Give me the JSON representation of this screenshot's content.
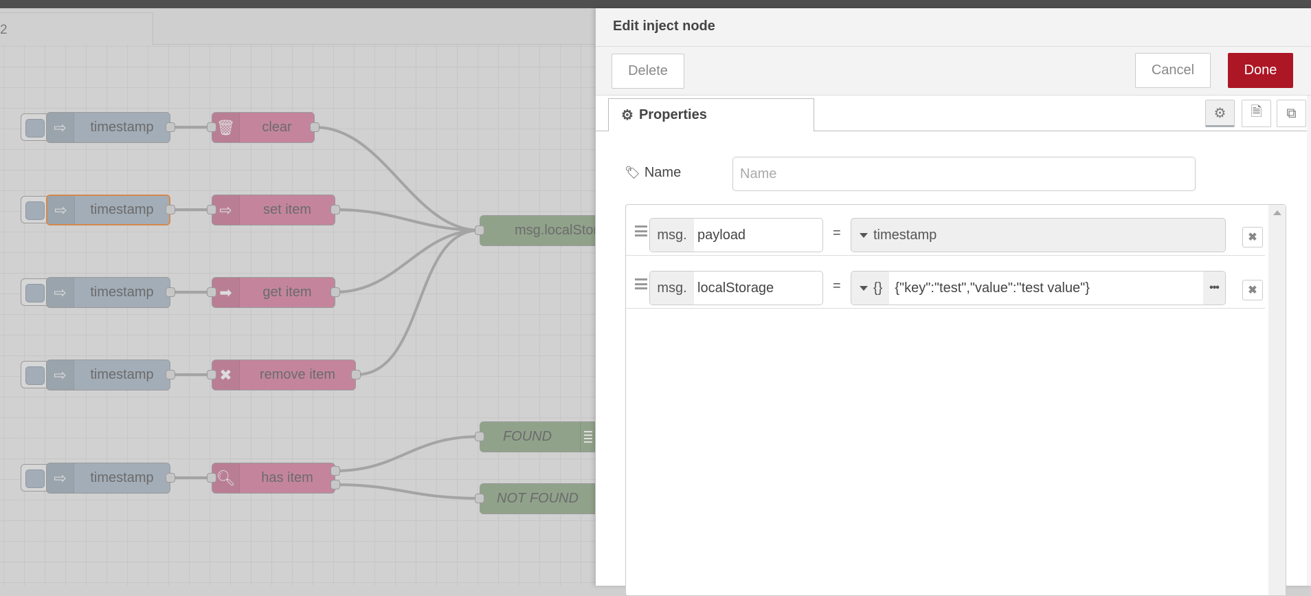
{
  "workspace": {
    "tab_label": "2",
    "nodes": {
      "inject": [
        {
          "label": "timestamp",
          "selected": false
        },
        {
          "label": "timestamp",
          "selected": true
        },
        {
          "label": "timestamp",
          "selected": false
        },
        {
          "label": "timestamp",
          "selected": false
        },
        {
          "label": "timestamp",
          "selected": false
        }
      ],
      "functions": [
        {
          "label": "clear",
          "icon": "trash-icon"
        },
        {
          "label": "set item",
          "icon": "arrow-right-icon"
        },
        {
          "label": "get item",
          "icon": "arrow-right-solid-icon"
        },
        {
          "label": "remove item",
          "icon": "close-icon"
        },
        {
          "label": "has item",
          "icon": "search-icon"
        }
      ],
      "debug": [
        {
          "label": "msg.localStorage"
        },
        {
          "label": "FOUND"
        },
        {
          "label": "NOT FOUND"
        }
      ]
    },
    "colors": {
      "inject": "#a3adb7",
      "function": "#c4859c",
      "debug": "#91a28b",
      "selected": "#d3894d"
    }
  },
  "panel": {
    "title": "Edit inject node",
    "delete_label": "Delete",
    "cancel_label": "Cancel",
    "done_label": "Done",
    "done_color": "#ad1625",
    "tab_properties": "Properties",
    "name_label": "Name",
    "name_placeholder": "Name",
    "name_value": "",
    "properties": [
      {
        "prefix": "msg.",
        "key": "payload",
        "type": "timestamp",
        "type_icon": "",
        "value": ""
      },
      {
        "prefix": "msg.",
        "key": "localStorage",
        "type": "json",
        "type_icon": "{}",
        "value": "{\"key\":\"test\",\"value\":\"test value\"}"
      }
    ],
    "equals": "="
  }
}
